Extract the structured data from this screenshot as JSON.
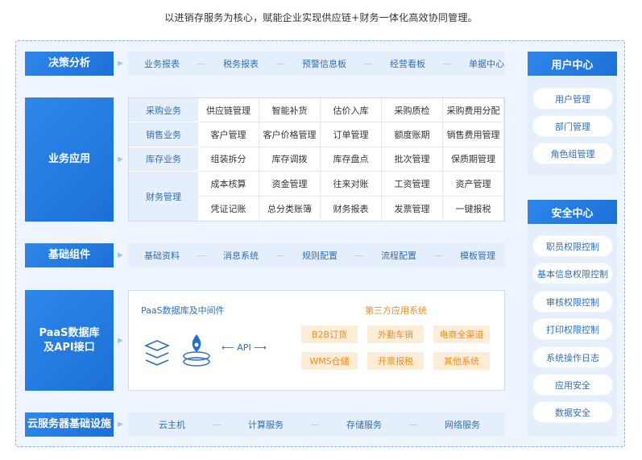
{
  "caption": "以进销存服务为核心，赋能企业实现供应链+财务一体化高效协同管理。",
  "rows": {
    "decision": {
      "label": "决策分析",
      "items": [
        "业务报表",
        "税务报表",
        "预警信息板",
        "经营看板",
        "单据中心"
      ]
    },
    "business": {
      "label": "业务应用",
      "groups": [
        {
          "name": "采购业务",
          "items": [
            "供应链管理",
            "智能补货",
            "估价入库",
            "采购质检",
            "采购费用分配"
          ]
        },
        {
          "name": "销售业务",
          "items": [
            "客户管理",
            "客户价格管理",
            "订单管理",
            "额度账期",
            "销售费用管理"
          ]
        },
        {
          "name": "库存业务",
          "items": [
            "组装拆分",
            "库存调拨",
            "库存盘点",
            "批次管理",
            "保质期管理"
          ]
        },
        {
          "name": "财务管理",
          "items": [
            "成本核算",
            "资金管理",
            "往来对账",
            "工资管理",
            "资产管理",
            "凭证记账",
            "总分类账簿",
            "财务报表",
            "发票管理",
            "一键报税"
          ]
        }
      ]
    },
    "components": {
      "label": "基础组件",
      "items": [
        "基础资料",
        "消息系统",
        "规则配置",
        "流程配置",
        "模板管理"
      ]
    },
    "paas": {
      "label": "PaaS数据库\n及API接口",
      "db_title": "PaaS数据库及中间件",
      "api": "API",
      "third_title": "第三方应用系统",
      "apps": [
        "B2B订货",
        "外勤车销",
        "电商全渠道",
        "WMS仓储",
        "开票报税",
        "其他系统"
      ]
    },
    "cloud": {
      "label": "云服务器基础设施",
      "items": [
        "云主机",
        "计算服务",
        "存储服务",
        "网络服务"
      ]
    }
  },
  "side": {
    "user_center": {
      "title": "用户中心",
      "items": [
        "用户管理",
        "部门管理",
        "角色组管理"
      ]
    },
    "security_center": {
      "title": "安全中心",
      "items": [
        "职员权限控制",
        "基本信息权限控制",
        "审核权限控制",
        "打印权限控制",
        "系统操作日志",
        "应用安全",
        "数据安全"
      ]
    }
  },
  "colors": {
    "primary": "#1c6fd6",
    "band": "#e5effc",
    "accent": "#f08c1e",
    "accent_bg": "#fdecd6"
  },
  "icons": [
    "layers-icon",
    "database-icon",
    "chevron-right-icon"
  ]
}
